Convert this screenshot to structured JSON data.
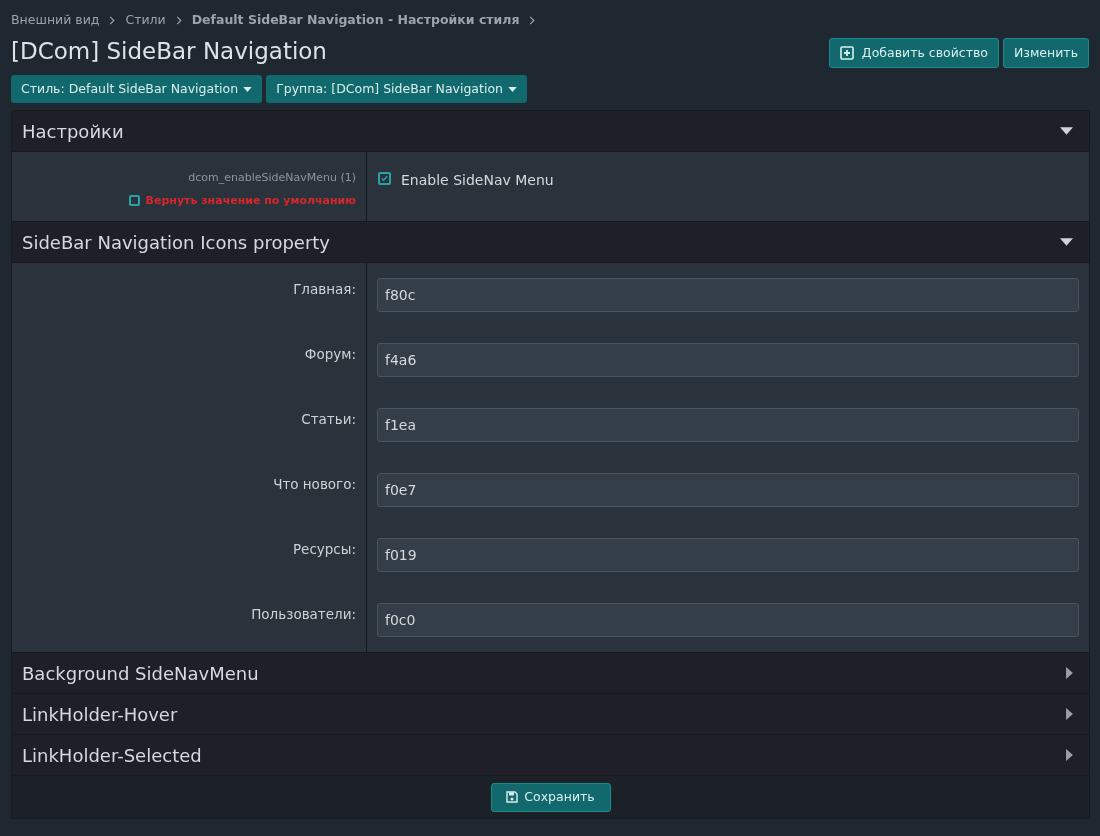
{
  "breadcrumb": [
    {
      "label": "Внешний вид",
      "bold": false
    },
    {
      "label": "Стили",
      "bold": false
    },
    {
      "label": "Default SideBar Navigation - Настройки стиля",
      "bold": true
    }
  ],
  "title": "[DCom] SideBar Navigation",
  "header_buttons": [
    {
      "label": "Добавить свойство",
      "kind": "add"
    },
    {
      "label": "Изменить",
      "kind": "plain"
    }
  ],
  "filters": [
    {
      "label": "Стиль: Default SideBar Navigation"
    },
    {
      "label": "Группа: [DCom] SideBar Navigation"
    }
  ],
  "sections": [
    {
      "title": "Настройки",
      "expanded": true,
      "rows": [
        {
          "kind": "checkbox",
          "name": "dcom_enableSideNavMenu (1)",
          "revert": {
            "label": "Вернуть значение по умолчанию",
            "checked": false
          },
          "option": "Enable SideNav Menu",
          "checked": true
        }
      ]
    },
    {
      "title": "SideBar Navigation Icons property",
      "expanded": true,
      "rows": [
        {
          "kind": "text",
          "label": "Главная:",
          "value": "f80c"
        },
        {
          "kind": "text",
          "label": "Форум:",
          "value": "f4a6"
        },
        {
          "kind": "text",
          "label": "Статьи:",
          "value": "f1ea"
        },
        {
          "kind": "text",
          "label": "Что нового:",
          "value": "f0e7"
        },
        {
          "kind": "text",
          "label": "Ресурсы:",
          "value": "f019"
        },
        {
          "kind": "text",
          "label": "Пользователи:",
          "value": "f0c0"
        }
      ]
    },
    {
      "title": "Background SideNavMenu",
      "expanded": false
    },
    {
      "title": "LinkHolder-Hover",
      "expanded": false
    },
    {
      "title": "LinkHolder-Selected",
      "expanded": false
    }
  ],
  "save_button": "Сохранить"
}
